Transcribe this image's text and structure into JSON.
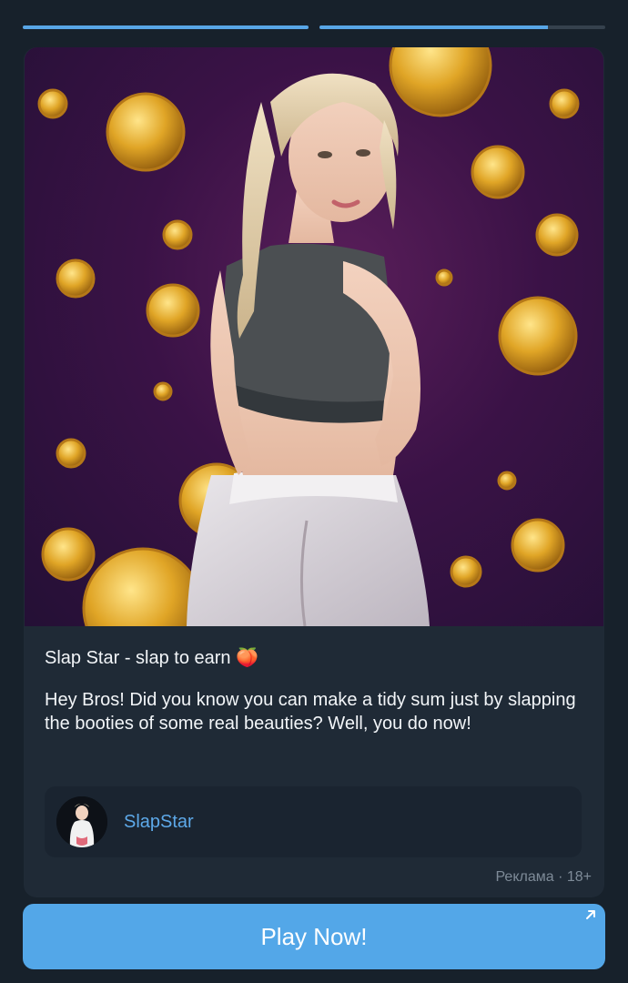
{
  "story_progress": [
    {
      "fill": 1.0
    },
    {
      "fill": 0.8
    }
  ],
  "ad": {
    "title": "Slap Star - slap to earn 🍑",
    "body": "Hey Bros! Did you know you can make a tidy sum just by slapping the booties of some real beauties? Well, you do now!",
    "channel_name": "SlapStar",
    "meta": "Реклама · 18+"
  },
  "cta": {
    "label": "Play Now!"
  },
  "colors": {
    "accent": "#53a7e8",
    "background": "#17212b",
    "card": "#1f2a36",
    "link": "#5da9e9"
  },
  "icons": {
    "open_link": "external-arrow-icon"
  }
}
